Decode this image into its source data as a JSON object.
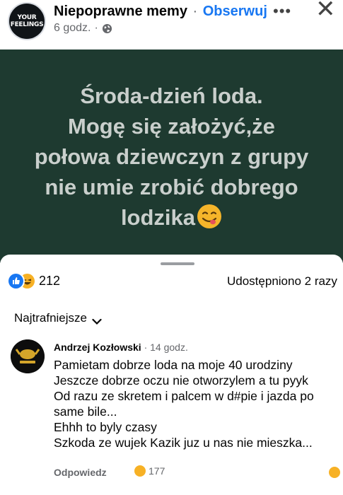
{
  "post": {
    "page_name": "Niepoprawne memy",
    "separator": "·",
    "follow_label": "Obserwuj",
    "time": "6 godz.",
    "time_separator": "·",
    "avatar_line1": "YOUR",
    "avatar_line2": "FEELINGS",
    "icons": {
      "more": "more-horizontal-icon",
      "close": "close-icon",
      "audience": "globe-icon"
    }
  },
  "image": {
    "background": "#1e3a30",
    "lines": [
      "Środa-dzień loda.",
      "Mogę się założyć,że",
      "połowa dziewczyn z grupy",
      "nie umie zrobić dobrego",
      "lodzika"
    ],
    "emoji": "face-savoring-food-emoji"
  },
  "stats": {
    "reaction_count": "212",
    "shares": "Udostępniono 2 razy",
    "reaction_icons": [
      "like-icon",
      "haha-icon"
    ]
  },
  "comments_section": {
    "sort_label": "Najtrafniejsze",
    "comments": [
      {
        "author": "Andrzej Kozłowski",
        "separator": "·",
        "time": "14 godz.",
        "lines": [
          "Pamietam dobrze loda na moje 40 urodziny",
          "Jeszcze dobrze oczu nie otworzylem a tu pyyk",
          "Od razu ze skretem i palcem w d#pie i jazda po",
          "same bile...",
          "Ehhh to byly czasy",
          "Szkoda ze wujek Kazik juz u nas nie mieszka..."
        ],
        "reply_label": "Odpowiedz",
        "reaction_count": "177"
      }
    ]
  },
  "colors": {
    "accent": "#1877f2",
    "secondary_text": "#65676b",
    "haha": "#f7b125"
  }
}
